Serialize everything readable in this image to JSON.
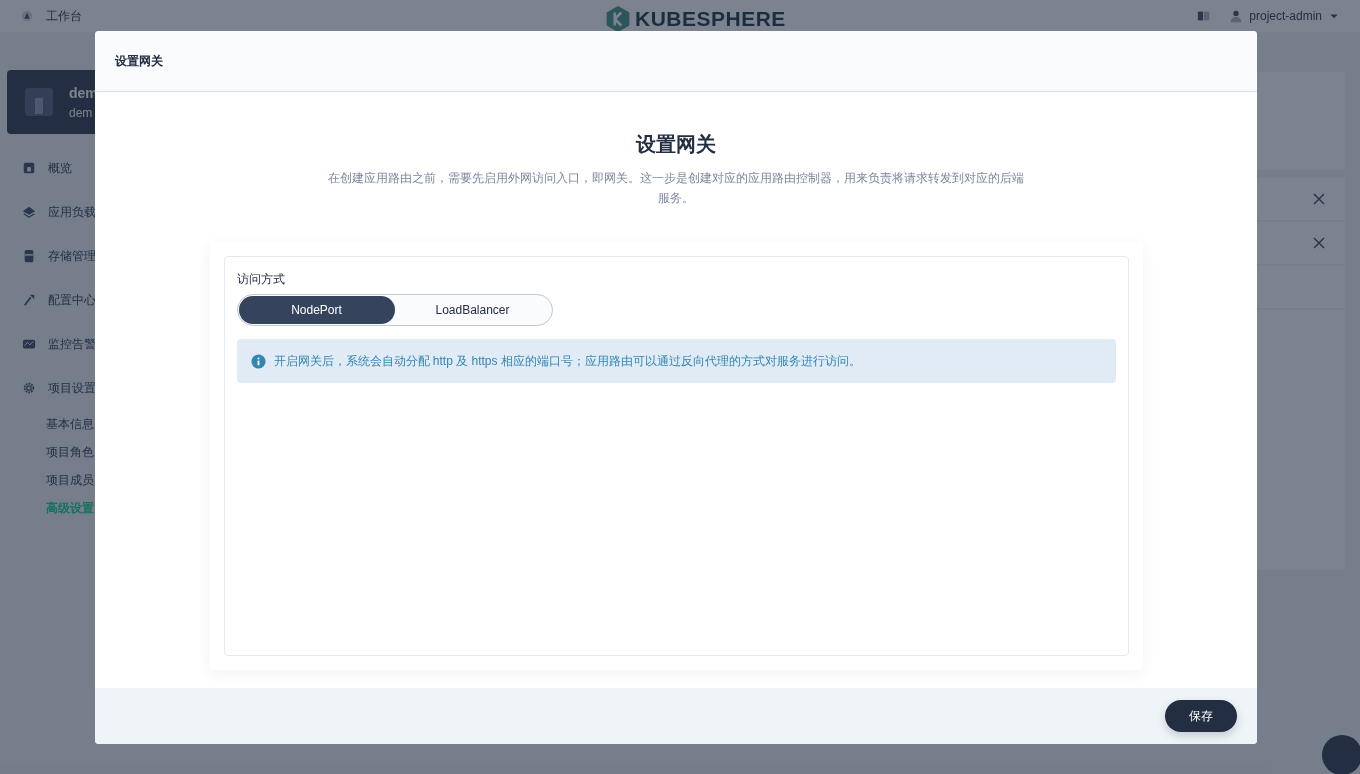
{
  "topbar": {
    "workbench": "工作台",
    "logo": "KUBESPHERE",
    "user": "project-admin"
  },
  "project_card": {
    "name": "dem",
    "subtitle": "dem"
  },
  "sidebar": {
    "items": [
      {
        "label": "概览"
      },
      {
        "label": "应用负载"
      },
      {
        "label": "存储管理"
      },
      {
        "label": "配置中心"
      },
      {
        "label": "监控告警"
      },
      {
        "label": "项目设置",
        "children": [
          {
            "label": "基本信息",
            "selected": false
          },
          {
            "label": "项目角色",
            "selected": false
          },
          {
            "label": "项目成员",
            "selected": false
          },
          {
            "label": "高级设置",
            "selected": true
          }
        ]
      }
    ]
  },
  "modal": {
    "header": "设置网关",
    "title": "设置网关",
    "description": "在创建应用路由之前，需要先启用外网访问入口，即网关。这一步是创建对应的应用路由控制器，用来负责将请求转发到对应的后端服务。",
    "access_label": "访问方式",
    "options": [
      {
        "label": "NodePort",
        "selected": true
      },
      {
        "label": "LoadBalancer",
        "selected": false
      }
    ],
    "info": "开启网关后，系统会自动分配 http 及 https 相应的端口号；应用路由可以通过反向代理的方式对服务进行访问。",
    "save": "保存"
  }
}
